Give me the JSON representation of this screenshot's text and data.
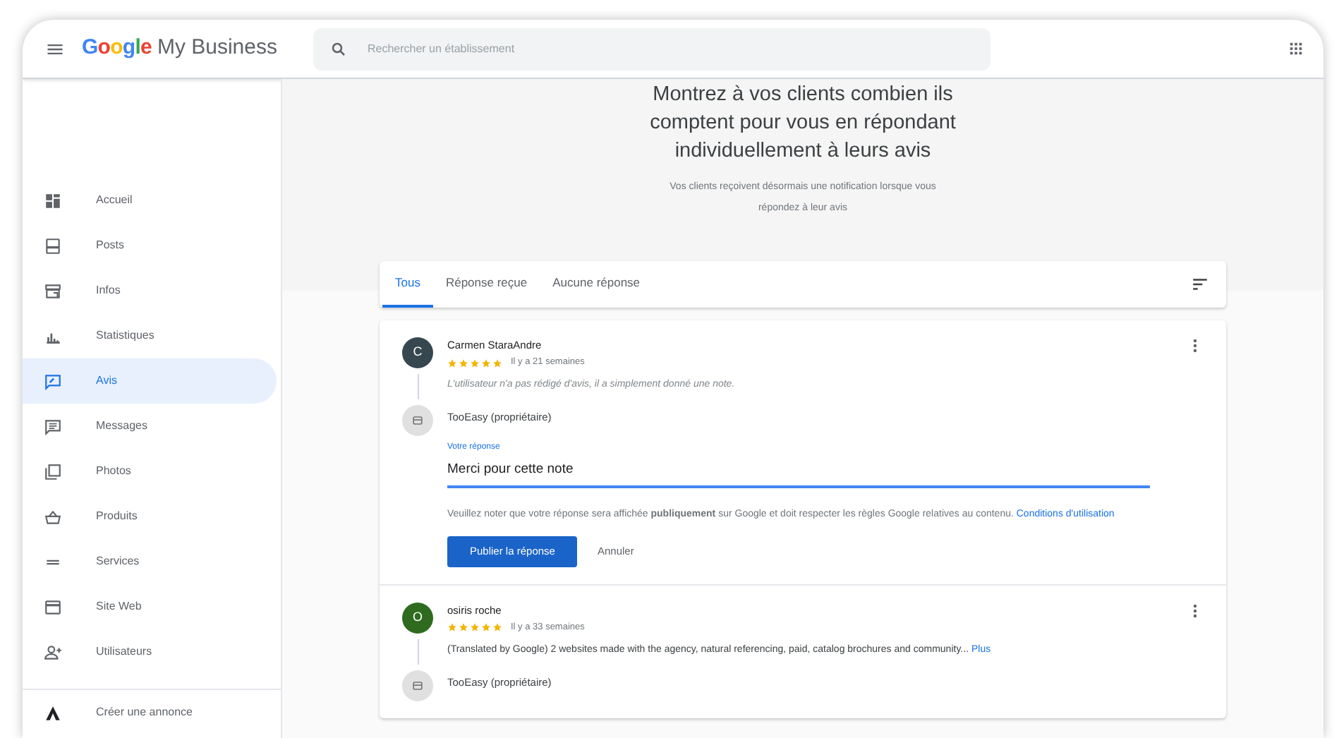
{
  "header": {
    "logo": "Google",
    "product": "My Business",
    "search": {
      "placeholder": "Rechercher un établissement"
    }
  },
  "sidebar": {
    "items": [
      {
        "label": "Accueil",
        "selected": false
      },
      {
        "label": "Posts",
        "selected": false
      },
      {
        "label": "Infos",
        "selected": false
      },
      {
        "label": "Statistiques",
        "selected": false
      },
      {
        "label": "Avis",
        "selected": true
      },
      {
        "label": "Messages",
        "selected": false
      },
      {
        "label": "Photos",
        "selected": false
      },
      {
        "label": "Produits",
        "selected": false
      },
      {
        "label": "Services",
        "selected": false
      },
      {
        "label": "Site Web",
        "selected": false
      },
      {
        "label": "Utilisateurs",
        "selected": false
      }
    ],
    "footer": {
      "label": "Créer une annonce"
    }
  },
  "banner": {
    "title": "Montrez à vos clients combien ils comptent pour vous en répondant individuellement à leurs avis",
    "subtitle": "Vos clients reçoivent désormais une notification lorsque vous répondez à leur avis"
  },
  "tabs": [
    {
      "label": "Tous",
      "selected": true
    },
    {
      "label": "Réponse reçue",
      "selected": false
    },
    {
      "label": "Aucune réponse",
      "selected": false
    }
  ],
  "reviews": [
    {
      "avatar": "C",
      "color": "#37474f",
      "name": "Carmen StaraAndre",
      "stars": 5,
      "time": "Il y a 21 semaines",
      "kind": "rating_only",
      "text": "L'utilisateur n'a pas rédigé d'avis, il a simplement donné une note.",
      "owner": "TooEasy (propriétaire)",
      "reply": {
        "label": "Votre réponse",
        "value": "Merci pour cette note",
        "notice": "Veuillez noter que votre réponse sera affichée **publiquement** sur Google et doit respecter les règles Google relatives au contenu.",
        "link": "Conditions d'utilisation",
        "submit": "Publier la réponse",
        "cancel": "Annuler"
      }
    },
    {
      "avatar": "O",
      "color": "#2e6b1f",
      "name": "osiris roche",
      "stars": 5,
      "time": "Il y a 33 semaines",
      "kind": "comment",
      "text": "(Translated by Google) 2 websites made with the agency, natural referencing, paid, catalog brochures and community...",
      "more": "Plus",
      "owner": "TooEasy (propriétaire)"
    }
  ]
}
